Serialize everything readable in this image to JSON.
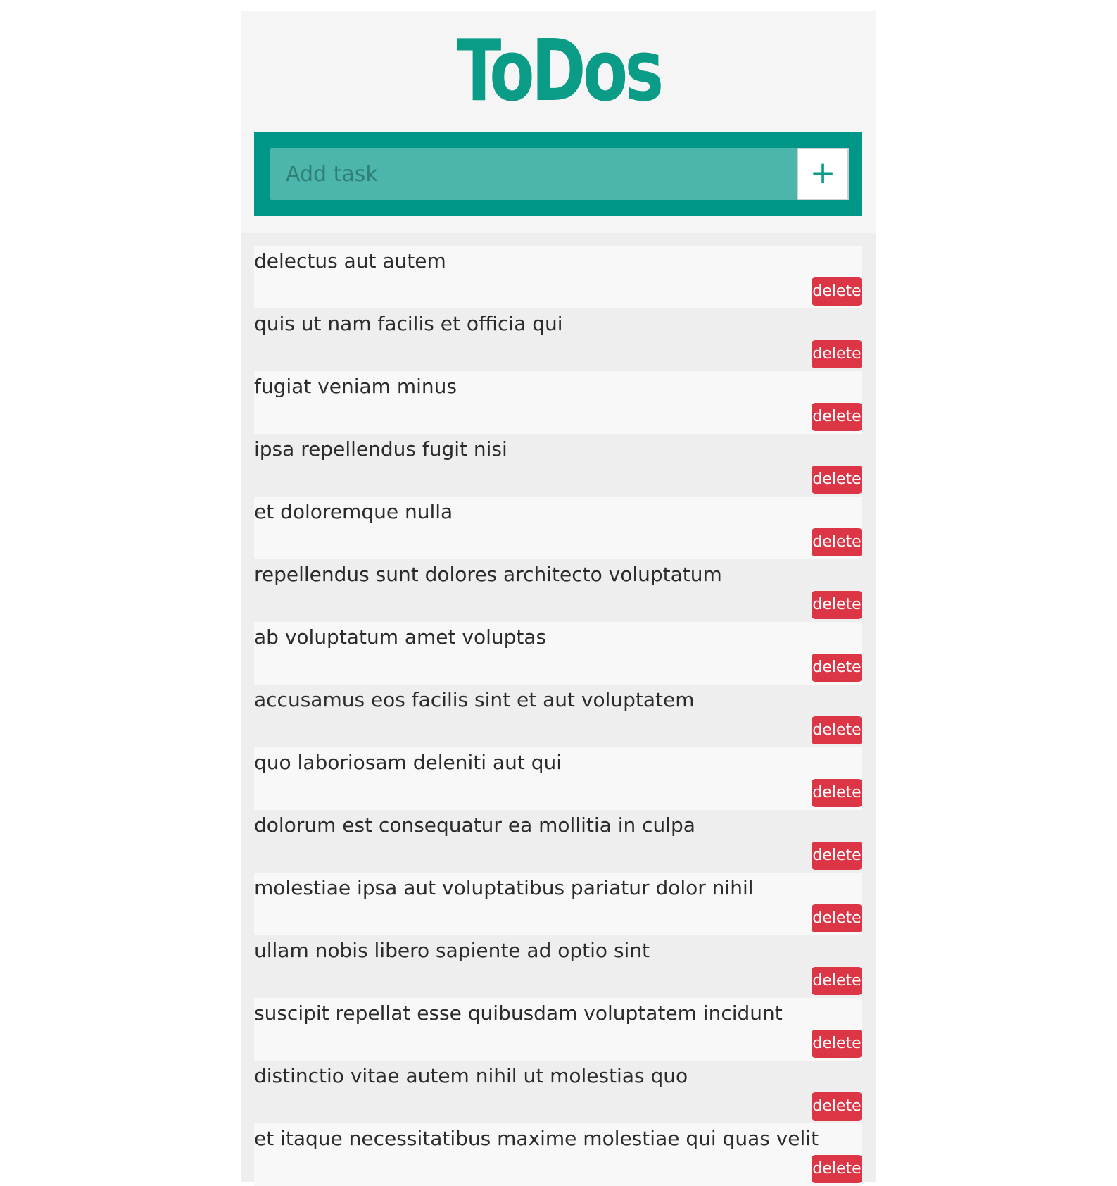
{
  "header": {
    "title": "ToDos"
  },
  "add_task": {
    "placeholder": "Add task",
    "add_button_label": "+"
  },
  "todos": [
    {
      "text": "delectus aut autem",
      "delete_label": "delete"
    },
    {
      "text": "quis ut nam facilis et officia qui",
      "delete_label": "delete"
    },
    {
      "text": "fugiat veniam minus",
      "delete_label": "delete"
    },
    {
      "text": "ipsa repellendus fugit nisi",
      "delete_label": "delete"
    },
    {
      "text": "et doloremque nulla",
      "delete_label": "delete"
    },
    {
      "text": "repellendus sunt dolores architecto voluptatum",
      "delete_label": "delete"
    },
    {
      "text": "ab voluptatum amet voluptas",
      "delete_label": "delete"
    },
    {
      "text": "accusamus eos facilis sint et aut voluptatem",
      "delete_label": "delete"
    },
    {
      "text": "quo laboriosam deleniti aut qui",
      "delete_label": "delete"
    },
    {
      "text": "dolorum est consequatur ea mollitia in culpa",
      "delete_label": "delete"
    },
    {
      "text": "molestiae ipsa aut voluptatibus pariatur dolor nihil",
      "delete_label": "delete"
    },
    {
      "text": "ullam nobis libero sapiente ad optio sint",
      "delete_label": "delete"
    },
    {
      "text": "suscipit repellat esse quibusdam voluptatem incidunt",
      "delete_label": "delete"
    },
    {
      "text": "distinctio vitae autem nihil ut molestias quo",
      "delete_label": "delete"
    },
    {
      "text": "et itaque necessitatibus maxime molestiae qui quas velit",
      "delete_label": "delete"
    }
  ],
  "colors": {
    "title": "#0a9c86",
    "add_bar": "#009688",
    "add_input": "#4db6ac",
    "delete_button": "#dc3545",
    "row_light": "#f8f8f8",
    "row_dark": "#eeeeee"
  }
}
